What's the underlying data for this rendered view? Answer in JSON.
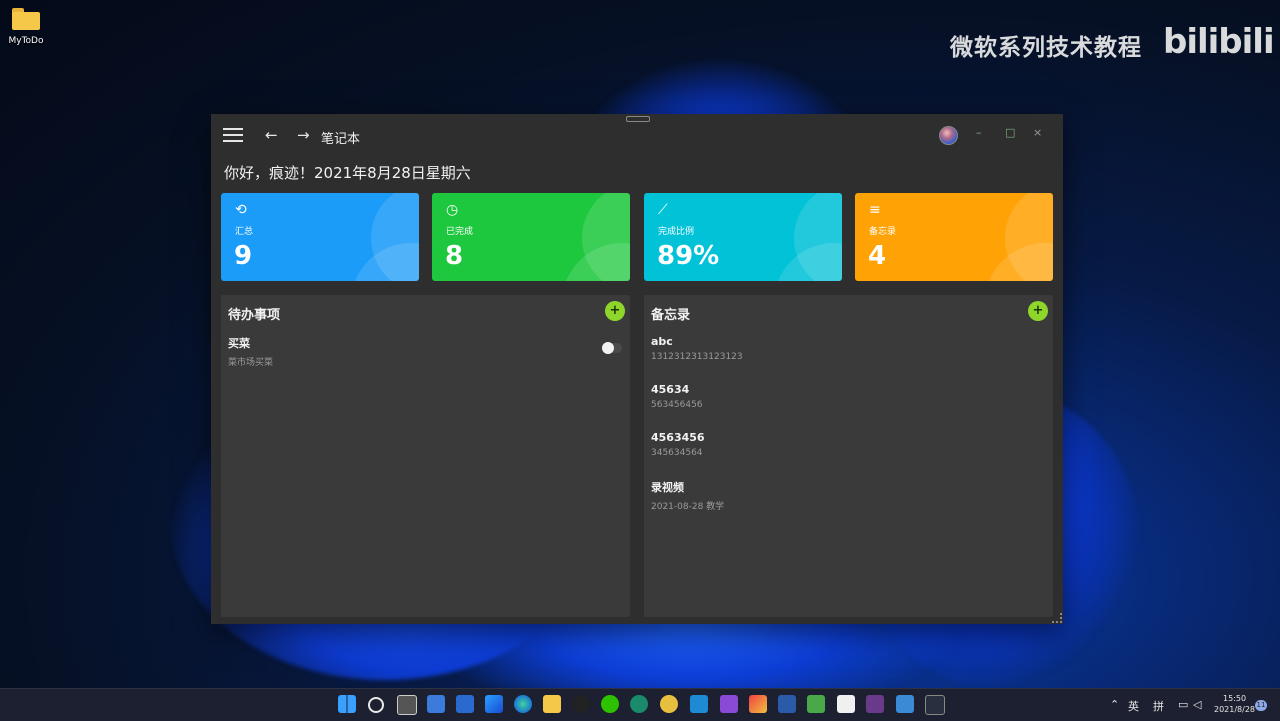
{
  "desktop": {
    "icon_label": "MyToDo"
  },
  "watermark": {
    "text": "微软系列技术教程",
    "brand": "bilibili"
  },
  "window": {
    "title": "笔记本",
    "greeting": "你好，痕迹！2021年8月28日星期六",
    "controls": {
      "minimize": "–",
      "maximize": "□",
      "close": "×"
    }
  },
  "cards": [
    {
      "label": "汇总",
      "value": "9",
      "color": "#1a9cf8",
      "icon": "history-icon"
    },
    {
      "label": "已完成",
      "value": "8",
      "color": "#1ec83e",
      "icon": "clock-check-icon"
    },
    {
      "label": "完成比例",
      "value": "89%",
      "color": "#02c2d8",
      "icon": "trend-line-icon"
    },
    {
      "label": "备忘录",
      "value": "4",
      "color": "#ffa206",
      "icon": "playlist-add-icon"
    }
  ],
  "todo": {
    "title": "待办事项",
    "items": [
      {
        "title": "买菜",
        "subtitle": "菜市场买菜",
        "done": false
      }
    ]
  },
  "memo": {
    "title": "备忘录",
    "items": [
      {
        "title": "abc",
        "subtitle": "1312312313123123"
      },
      {
        "title": "45634",
        "subtitle": "563456456"
      },
      {
        "title": "4563456",
        "subtitle": "345634564"
      },
      {
        "title": "录视频",
        "subtitle": "2021-08-28 教学"
      }
    ]
  },
  "taskbar": {
    "lang": "英",
    "ime": "拼",
    "time": "15:50",
    "date": "2021/8/28",
    "notifications": "11"
  },
  "accent_colors": {
    "add_button": "#8fd62a",
    "panel_bg": "#3a3a3a",
    "window_bg": "#2e2e2e"
  }
}
